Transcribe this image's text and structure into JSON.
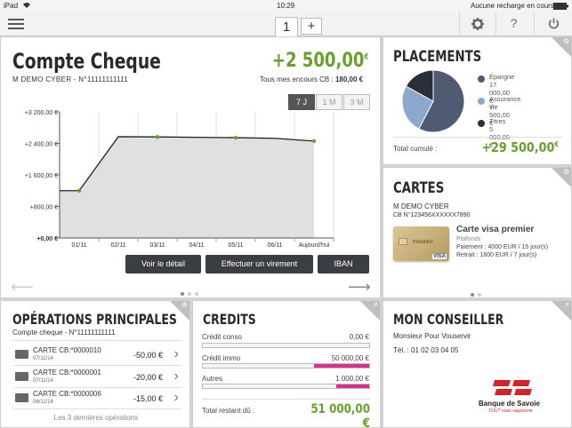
{
  "status": {
    "device": "iPad",
    "wifi": "wifi-icon",
    "time": "10:29",
    "charge": "Aucune recharge en cours",
    "battery": "battery-icon"
  },
  "nav": {
    "tab_active": "1",
    "tab_add": "+",
    "settings": "gear-icon",
    "help": "?",
    "power": "power-icon"
  },
  "account": {
    "title": "Compte Cheque",
    "balance": "+2 500,00",
    "currency": "€",
    "holder": "M DEMO CYBER - N°11111111111",
    "encours_label": "Tous mes encours CB :",
    "encours_value": "180,00 €",
    "periods": [
      "7 J",
      "1 M",
      "3 M"
    ],
    "active_period": "7 J",
    "buttons": {
      "detail": "Voir le détail",
      "transfer": "Effectuer un virement",
      "iban": "IBAN"
    }
  },
  "chart_data": {
    "type": "area",
    "y_ticks": [
      "+3 200,00 €",
      "+2 400,00 €",
      "+1 600,00 €",
      "+800,00 €",
      "+0,00 €"
    ],
    "ylim": [
      0,
      3200
    ],
    "categories": [
      "01/11",
      "02/11",
      "03/11",
      "04/11",
      "05/11",
      "06/11",
      "Aujourd'hui"
    ],
    "series": [
      {
        "x": [
          -0.5,
          0,
          1,
          2,
          3,
          4,
          5,
          6
        ],
        "values": [
          1200,
          1200,
          2570,
          2565,
          2555,
          2545,
          2530,
          2460
        ],
        "points": [
          1,
          3,
          5,
          7
        ]
      }
    ],
    "area_color": "#e0e0e0",
    "line_color": "#222222",
    "point_color": "#6a9e2f"
  },
  "placements": {
    "title": "PLACEMENTS",
    "legend": [
      {
        "name": "Épargne",
        "value": "17 000,00 €",
        "color": "#4f5b73"
      },
      {
        "name": "Assurance vie",
        "value": "7 500,00 €",
        "color": "#8ea7cd"
      },
      {
        "name": "Titres",
        "value": "5 000,00 €",
        "color": "#2a2f3a"
      }
    ],
    "total_label": "Total cumulé :",
    "total_value": "+29 500,00",
    "currency": "€",
    "pie": [
      17000,
      7500,
      5000
    ]
  },
  "cartes": {
    "title": "CARTES",
    "holder": "M DEMO CYBER",
    "number": "CB N°123456XXXXXX7890",
    "card_name": "Carte visa premier",
    "limits_label": "Plafonds",
    "payment": "Paiement : 4000 EUR / 15 jour(s)",
    "withdrawal": "Retrait : 1600 EUR / 7 jour(s)",
    "card_brand": "PREMIER",
    "card_network": "VISA"
  },
  "operations": {
    "title": "OPÉRATIONS PRINCIPALES",
    "account": "Compte cheque - N°11111111111",
    "rows": [
      {
        "label": "CARTE CB:*0000010",
        "date": "07/11/14",
        "amount": "-50,00 €"
      },
      {
        "label": "CARTE CB:*0000001",
        "date": "07/11/14",
        "amount": "-20,00 €"
      },
      {
        "label": "CARTE CB:*0000006",
        "date": "06/11/14",
        "amount": "-15,00 €"
      }
    ],
    "footer": "Les 3 dernières opérations"
  },
  "credits": {
    "title": "CREDITS",
    "rows": [
      {
        "label": "Crédit conso",
        "value": "0,00 €",
        "progress": 0
      },
      {
        "label": "Crédit immo",
        "value": "50 000,00 €",
        "progress": 0.33
      },
      {
        "label": "Autres",
        "value": "1 000,00 €",
        "progress": 0.2
      }
    ],
    "total_label": "Total restant dû :",
    "total_value": "51 000,00 €"
  },
  "conseiller": {
    "title": "MON CONSEILLER",
    "name": "Monsieur Pour Vouservir",
    "phone": "Tél. : 01 02 03 04 05",
    "bank_name": "Banque de Savoie",
    "slogan": "TOUT nous rapproche"
  }
}
